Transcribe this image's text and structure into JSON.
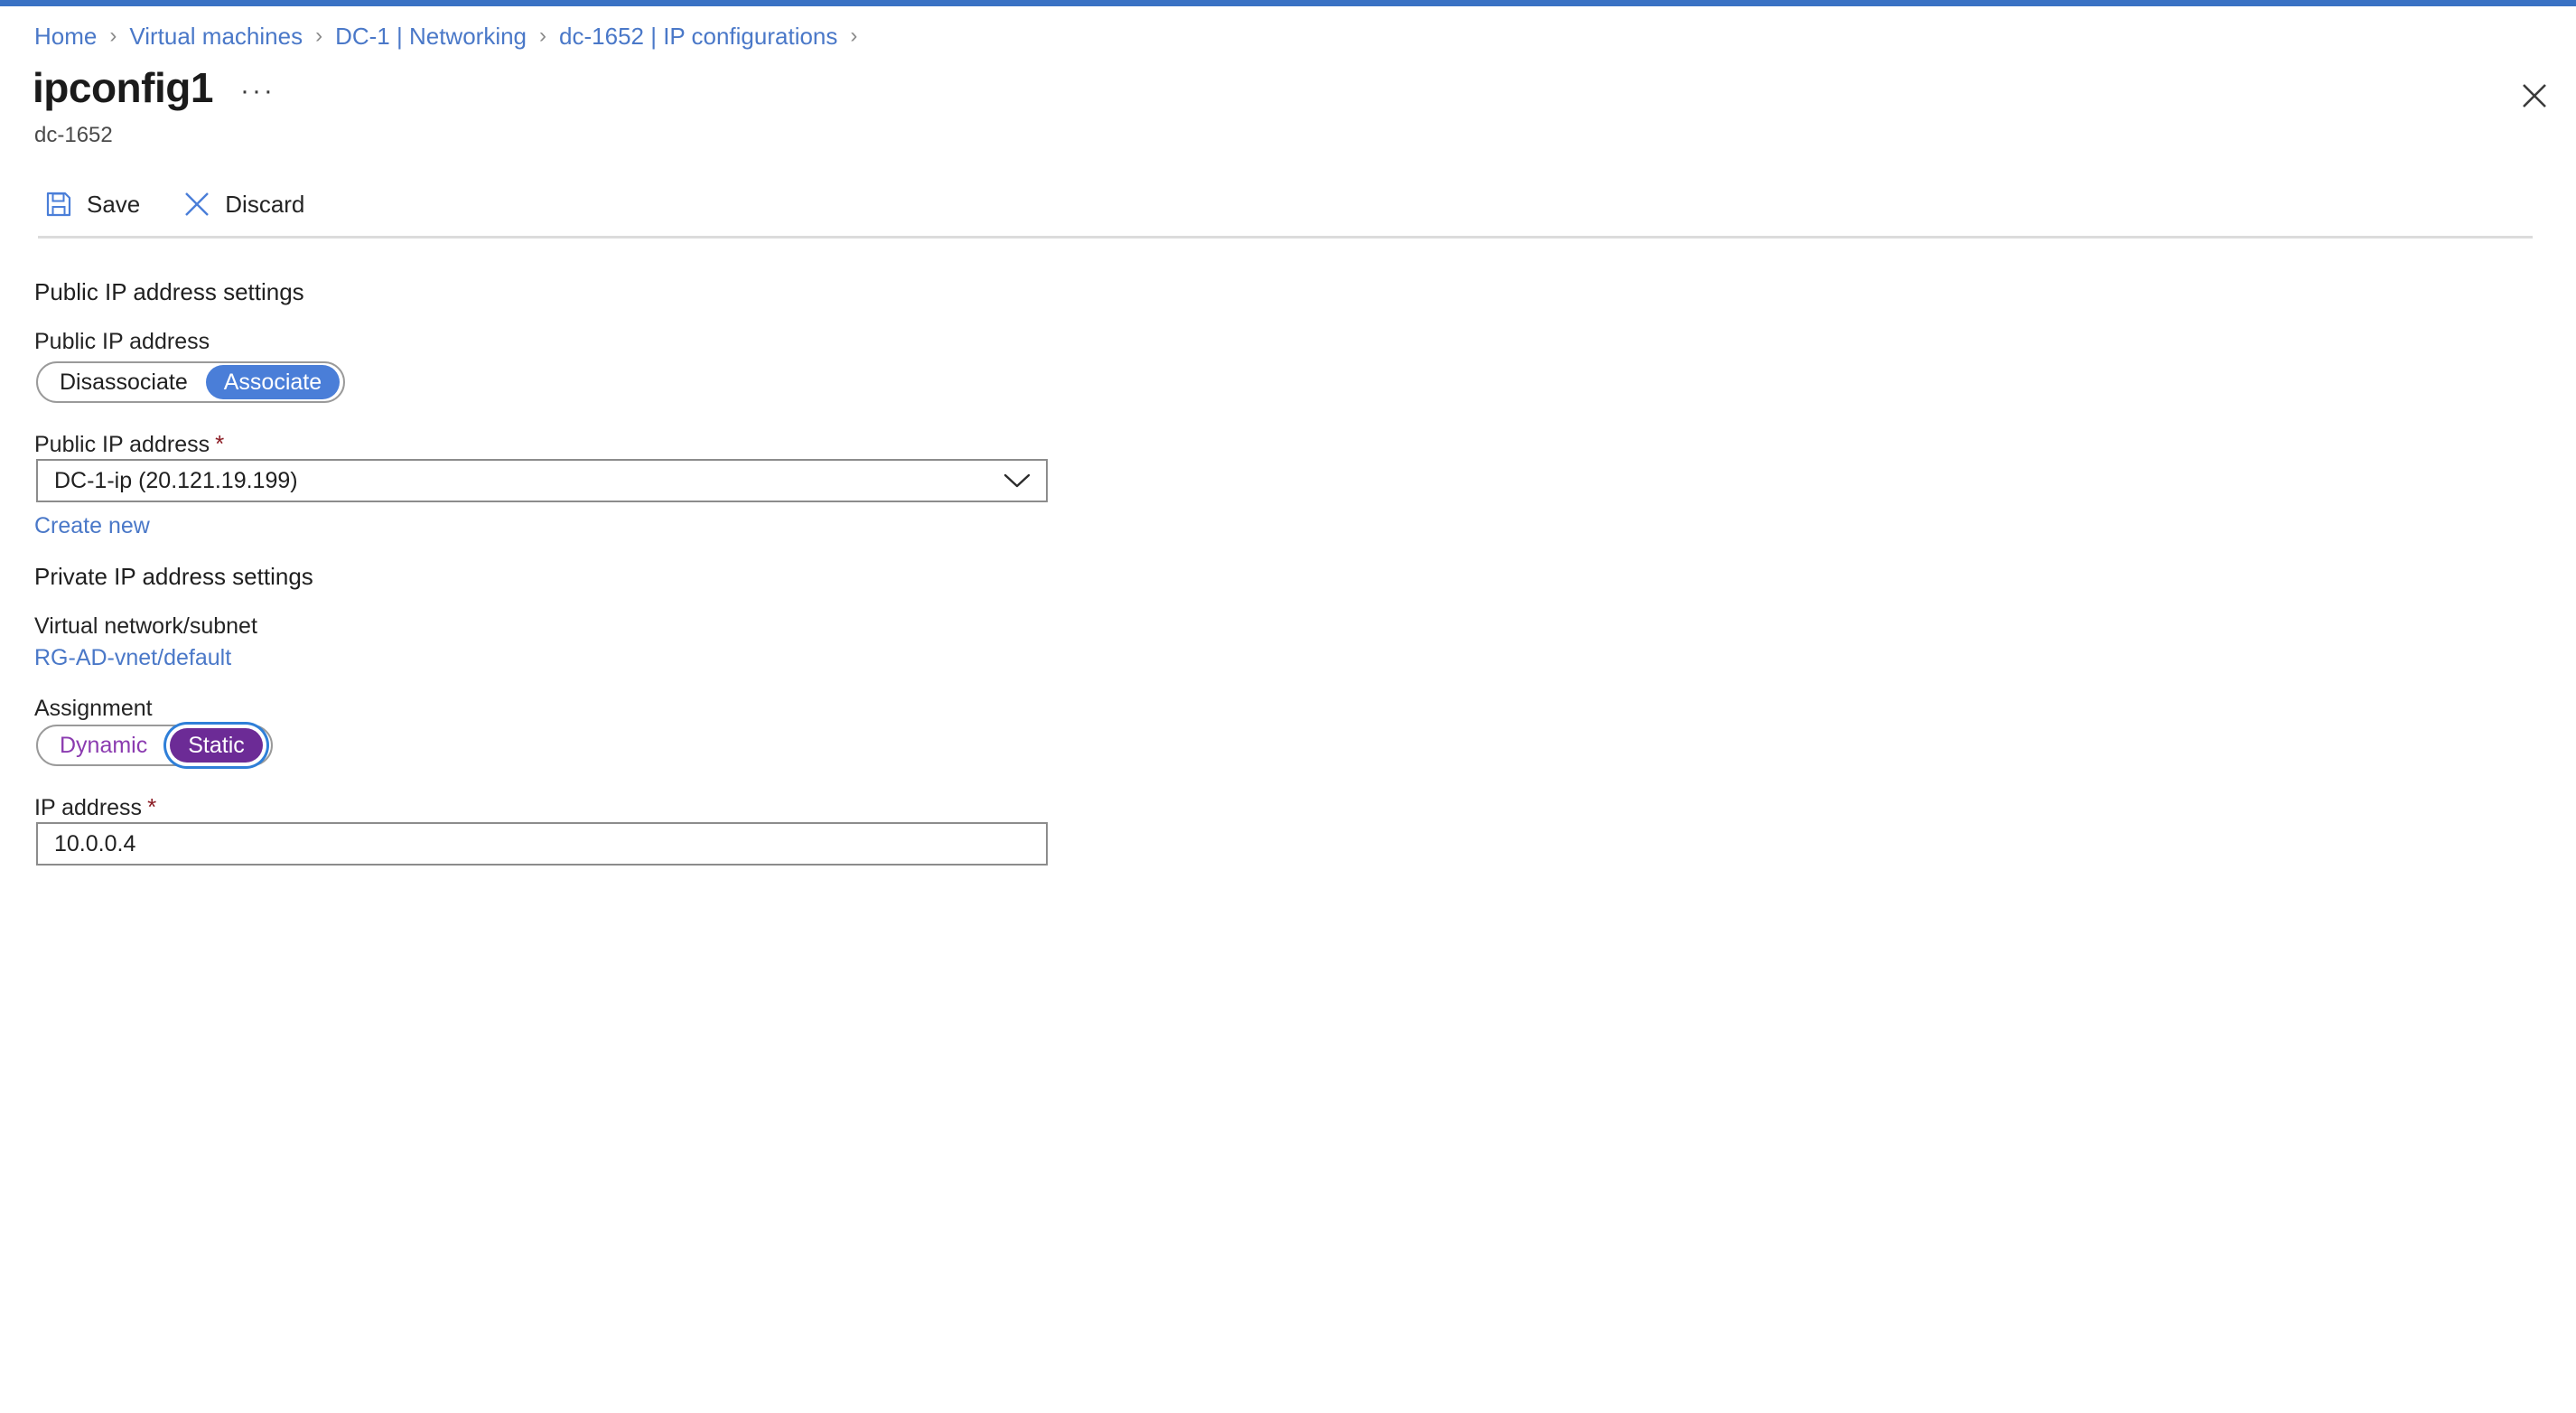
{
  "theme": {
    "accent_bar": "#3a72c4",
    "link_blue": "#4a78c8",
    "toggle_blue": "#4a7ed8",
    "toggle_purple": "#6c2b96",
    "visited_purple": "#8b3bb0",
    "required_red": "#8b1c24",
    "border_gray": "#8c8c8c",
    "background": "#ffffff"
  },
  "breadcrumb": {
    "separator": "›",
    "items": [
      {
        "label": "Home"
      },
      {
        "label": "Virtual machines"
      },
      {
        "label": "DC-1 | Networking"
      },
      {
        "label": "dc-1652 | IP configurations"
      }
    ],
    "trailing_separator": "›"
  },
  "header": {
    "title": "ipconfig1",
    "ellipsis": "···",
    "subtitle": "dc-1652",
    "close_icon": "close-icon"
  },
  "command_bar": {
    "buttons": [
      {
        "label": "Save",
        "icon": "save-icon"
      },
      {
        "label": "Discard",
        "icon": "discard-icon"
      }
    ]
  },
  "form": {
    "public_ip_section": {
      "heading": "Public IP address settings",
      "toggle_label": "Public IP address",
      "toggle": {
        "options": [
          {
            "label": "Disassociate",
            "selected": false
          },
          {
            "label": "Associate",
            "selected": true
          }
        ]
      },
      "select_label": "Public IP address",
      "select_required": "*",
      "select_value": "DC-1-ip (20.121.19.199)",
      "create_new_link": "Create new",
      "chevron_icon": "chevron-down-icon"
    },
    "private_ip_section": {
      "heading": "Private IP address settings",
      "vnet_label": "Virtual network/subnet",
      "vnet_link": "RG-AD-vnet/default",
      "assignment_label": "Assignment",
      "assignment_toggle": {
        "options": [
          {
            "label": "Dynamic",
            "selected": false
          },
          {
            "label": "Static",
            "selected": true
          }
        ]
      },
      "ip_label": "IP address",
      "ip_required": "*",
      "ip_value": "10.0.0.4"
    }
  }
}
